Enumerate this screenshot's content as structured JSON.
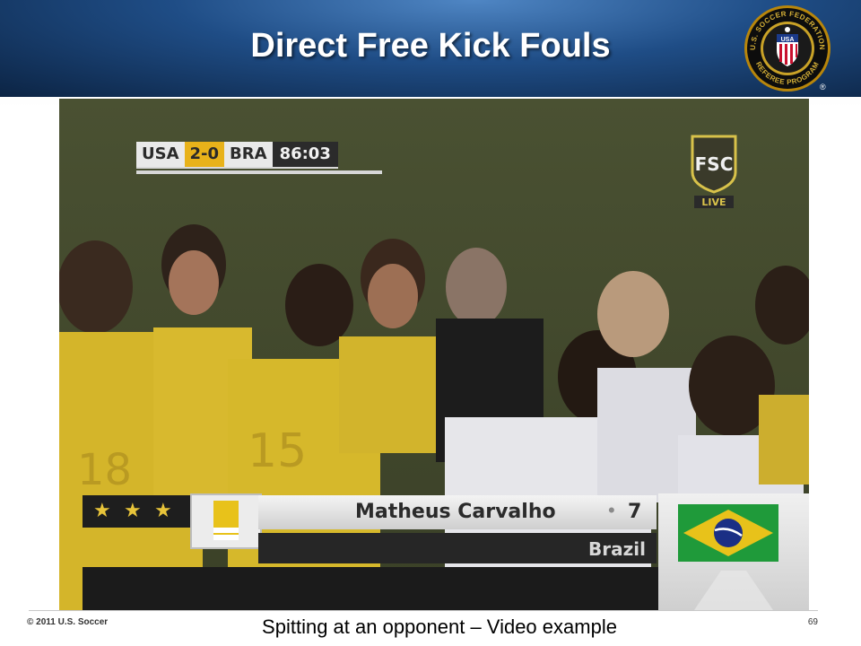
{
  "slide": {
    "title": "Direct Free Kick Fouls",
    "logo": {
      "top_text": "U.S. SOCCER FEDERATION",
      "bottom_text": "REFEREE PROGRAM",
      "center_text": "USA",
      "registered_mark": "®"
    },
    "caption": "Spitting at an opponent – Video example",
    "copyright": "© 2011 U.S. Soccer",
    "page_number": "69"
  },
  "video": {
    "scoreboard": {
      "home_team": "USA",
      "score": "2-0",
      "away_team": "BRA",
      "clock": "86:03"
    },
    "broadcaster_logo": {
      "text": "FSC",
      "status": "LIVE"
    },
    "lower_third": {
      "player_name": "Matheus Carvalho",
      "separator": "•",
      "player_number": "7",
      "country": "Brazil",
      "stars": [
        "★",
        "★",
        "★"
      ]
    },
    "shirt_numbers": [
      "18",
      "15"
    ]
  },
  "colors": {
    "header_blue": "#1f4d86",
    "brazil_yellow": "#e8c21a",
    "brazil_green": "#1f9a3a",
    "brazil_blue": "#1b2f85",
    "score_gold": "#e8b21a"
  }
}
